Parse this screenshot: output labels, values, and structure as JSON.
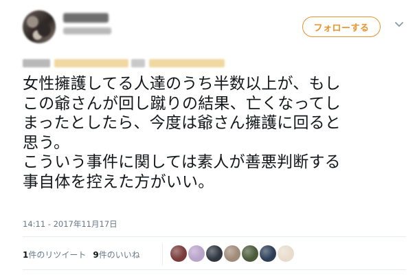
{
  "header": {
    "follow_label": "フォローする"
  },
  "tweet": {
    "text": "女性擁護してる人達のうち半数以上が、もし\nこの爺さんが回し蹴りの結果、亡くなってし\nまったとしたら、今度は爺さん擁護に回ると\n思う。\nこういう事件に関しては素人が善悪判断する\n事自体を控えた方がいい。",
    "timestamp": "14:11 - 2017年11月17日"
  },
  "stats": {
    "retweet_count": "1",
    "retweet_label": "件のリツイート",
    "like_count": "9",
    "like_label": "件のいいね"
  },
  "colors": {
    "accent": "#e8922a",
    "text": "#14171a",
    "muted": "#657786",
    "divider": "#e6ecf0"
  },
  "likers": [
    {
      "icon": "liker-avatar-1",
      "color": "#7a3b3b"
    },
    {
      "icon": "liker-avatar-2",
      "color": "#b8a3c9"
    },
    {
      "icon": "liker-avatar-3",
      "color": "#2f3640"
    },
    {
      "icon": "liker-avatar-4",
      "color": "#a08a78"
    },
    {
      "icon": "liker-avatar-5",
      "color": "#4b5a3a"
    },
    {
      "icon": "liker-avatar-6",
      "color": "#2d3e57"
    },
    {
      "icon": "liker-avatar-7",
      "color": "#e8dccd"
    }
  ]
}
